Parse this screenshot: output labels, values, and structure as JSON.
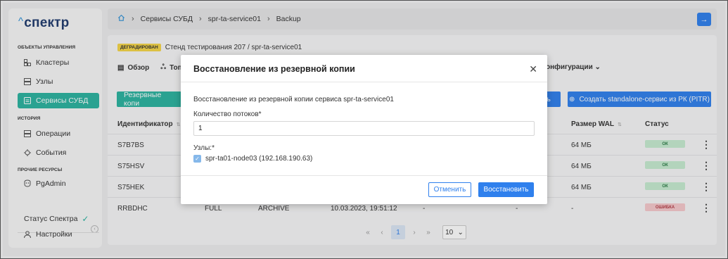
{
  "app": {
    "logo_caret": "^",
    "logo_text": "спектр"
  },
  "sidebar": {
    "sections": [
      {
        "title": "ОБЪЕКТЫ УПРАВЛЕНИЯ"
      },
      {
        "title": "ИСТОРИЯ"
      },
      {
        "title": "ПРОЧИЕ РЕСУРСЫ"
      }
    ],
    "items": [
      {
        "label": "Кластеры",
        "icon": "cluster-icon"
      },
      {
        "label": "Узлы",
        "icon": "server-icon"
      },
      {
        "label": "Сервисы СУБД",
        "icon": "database-icon",
        "active": true
      },
      {
        "label": "Операции",
        "icon": "server-icon"
      },
      {
        "label": "События",
        "icon": "events-icon"
      },
      {
        "label": "PgAdmin",
        "icon": "pgadmin-icon"
      }
    ],
    "status_label": "Статус Спектра",
    "settings_label": "Настройки"
  },
  "breadcrumb": [
    "Сервисы СУБД",
    "spr-ta-service01",
    "Backup"
  ],
  "subheader": {
    "badge": "ДЕГРАДИРОВАН",
    "path": "Стенд тестирования 207 /  spr-ta-service01"
  },
  "tabs": [
    {
      "label": "Обзор"
    },
    {
      "label": "Топ"
    }
  ],
  "tab_config": "онфигурации",
  "buttons": {
    "backups": "Резервные копи",
    "blue_fragment": "ть",
    "pitr": "Создать standalone-сервис из РК (PITR)"
  },
  "table": {
    "headers": {
      "id": "Идентификатор",
      "wal": "Размер WAL",
      "status": "Статус"
    },
    "rows": [
      {
        "id": "S7B7BS",
        "type": "",
        "method": "",
        "date": "",
        "size": "",
        "dur": "",
        "wal": "64 МБ",
        "status": "ОК",
        "status_kind": "ok"
      },
      {
        "id": "S75HSV",
        "type": "",
        "method": "",
        "date": "",
        "size": "",
        "dur": "",
        "wal": "64 МБ",
        "status": "ОК",
        "status_kind": "ok"
      },
      {
        "id": "S75HEK",
        "type": "",
        "method": "",
        "date": "",
        "size": "",
        "dur": "",
        "wal": "64 МБ",
        "status": "ОК",
        "status_kind": "ok"
      },
      {
        "id": "RRBDHC",
        "type": "FULL",
        "method": "ARCHIVE",
        "date": "10.03.2023, 19:51:12",
        "size": "-",
        "dur": "-",
        "wal": "-",
        "status": "ОШИБКА",
        "status_kind": "err"
      }
    ]
  },
  "pagination": {
    "first": "«",
    "prev": "‹",
    "current": "1",
    "next": "›",
    "last": "»",
    "page_size": "10"
  },
  "modal": {
    "title": "Восстановление из резервной копии",
    "description": "Восстановление из резервной копии сервиса spr-ta-service01",
    "threads_label": "Количество потоков*",
    "threads_value": "1",
    "nodes_label": "Узлы:*",
    "node": "spr-ta01-node03 (192.168.190.63)",
    "node_checked": true,
    "cancel": "Отменить",
    "restore": "Восстановить"
  },
  "colors": {
    "teal": "#2bb3a0",
    "blue": "#2f80ed",
    "ok_bg": "#c6ecd1",
    "err_bg": "#f6c9cc",
    "warn": "#f5d547"
  }
}
